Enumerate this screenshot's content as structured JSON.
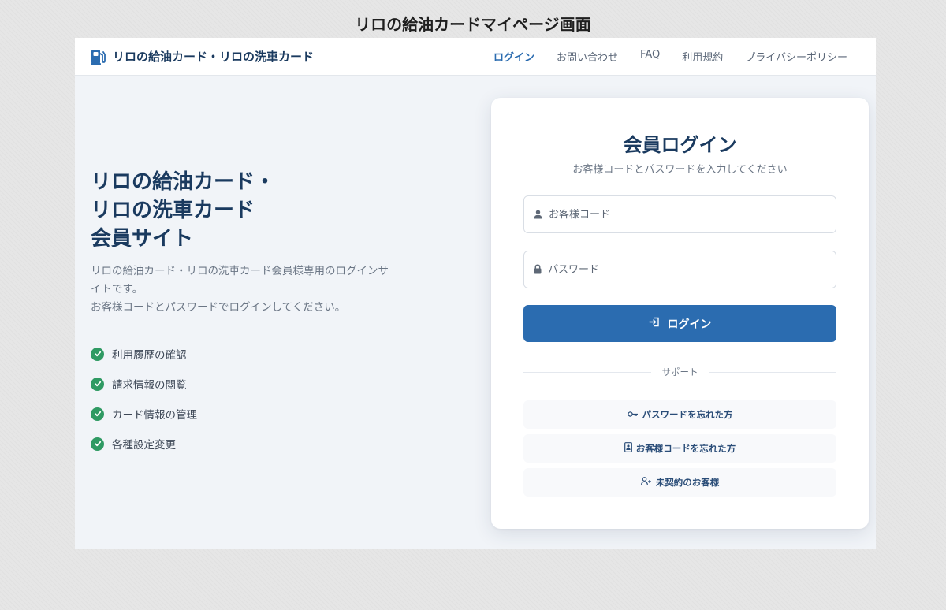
{
  "page_caption": "リロの給油カードマイページ画面",
  "navbar": {
    "brand": "リロの給油カード・リロの洗車カード",
    "brand_icon": "fuel-pump-icon",
    "links": [
      "ログイン",
      "お問い合わせ",
      "FAQ",
      "利用規約",
      "プライバシーポリシー"
    ],
    "active_link": "ログイン"
  },
  "hero": {
    "title_lines": [
      "リロの給油カード・",
      "リロの洗車カード",
      "会員サイト"
    ],
    "description_lines": [
      "リロの給油カード・リロの洗車カード会員様専用のログインサ",
      "イトです。",
      "お客様コードとパスワードでログインしてください。"
    ],
    "features": [
      "利用履歴の確認",
      "請求情報の閲覧",
      "カード情報の管理",
      "各種設定変更"
    ]
  },
  "login": {
    "title": "会員ログイン",
    "subtitle": "お客様コードとパスワードを入力してください",
    "customer_code_placeholder": "お客様コード",
    "password_placeholder": "パスワード",
    "submit_label": "ログイン",
    "divider_label": "サポート",
    "support_links": [
      {
        "label": "パスワードを忘れた方",
        "icon": "key-icon"
      },
      {
        "label": "お客様コードを忘れた方",
        "icon": "id-card-icon"
      },
      {
        "label": "未契約のお客様",
        "icon": "user-plus-icon"
      }
    ]
  },
  "colors": {
    "primary": "#2b6cb0",
    "heading": "#1a3a5f",
    "check": "#2f9a63"
  }
}
